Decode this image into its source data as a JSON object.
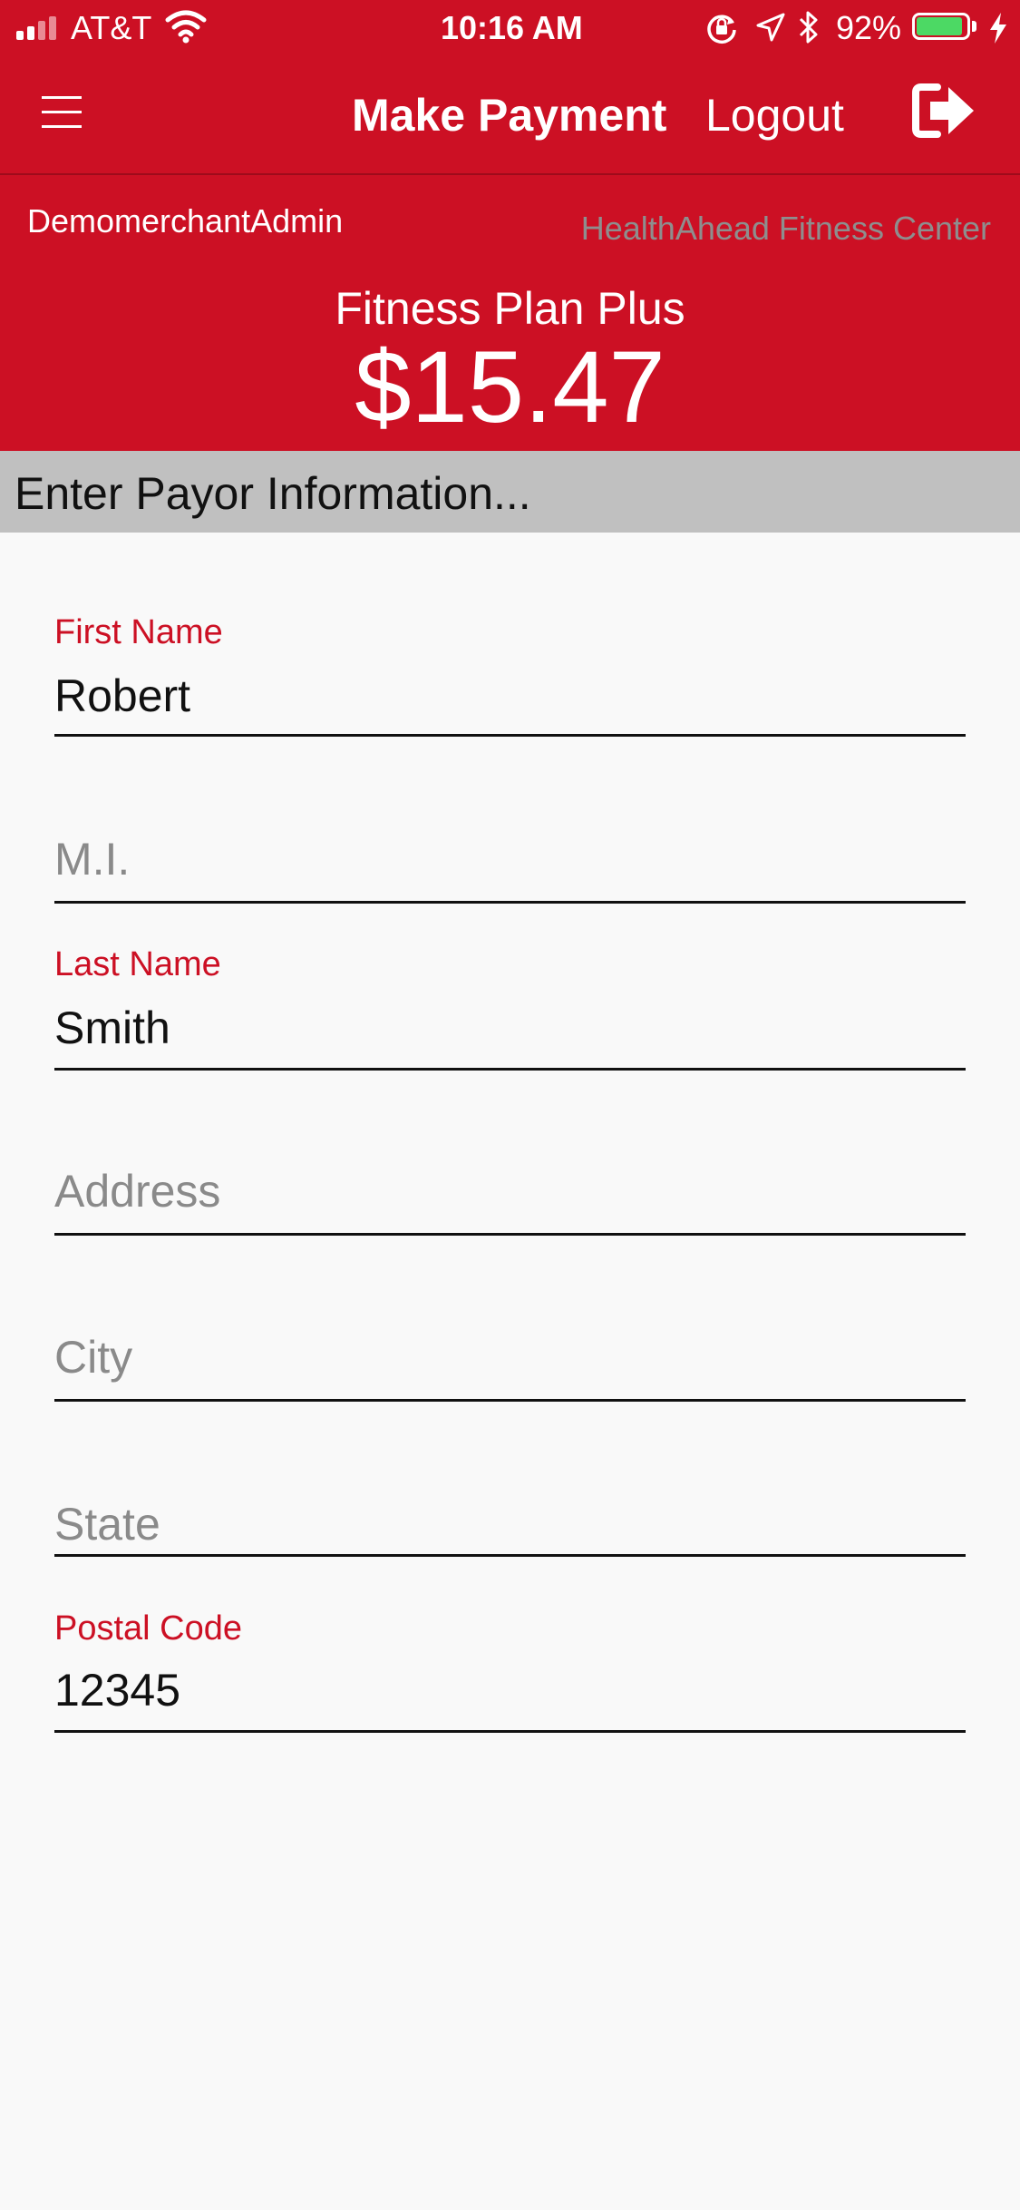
{
  "status_bar": {
    "carrier": "AT&T",
    "time": "10:16 AM",
    "battery_percent": "92%",
    "battery_level": 0.92,
    "icons": [
      "signal-icon",
      "wifi-icon",
      "orientation-lock-icon",
      "location-icon",
      "bluetooth-icon",
      "battery-icon",
      "charging-icon"
    ]
  },
  "navbar": {
    "title": "Make Payment",
    "logout_label": "Logout",
    "menu_icon": "hamburger-menu-icon",
    "logout_icon": "sign-out-icon"
  },
  "header": {
    "username": "DemomerchantAdmin",
    "merchant_name": "HealthAhead Fitness Center",
    "plan_name": "Fitness Plan Plus",
    "amount": "$15.47"
  },
  "section": {
    "title": "Enter Payor Information..."
  },
  "form": {
    "first_name": {
      "label": "First Name",
      "value": "Robert",
      "placeholder": "First Name"
    },
    "middle_initial": {
      "label": "",
      "value": "",
      "placeholder": "M.I."
    },
    "last_name": {
      "label": "Last Name",
      "value": "Smith",
      "placeholder": "Last Name"
    },
    "address": {
      "label": "",
      "value": "",
      "placeholder": "Address"
    },
    "city": {
      "label": "",
      "value": "",
      "placeholder": "City"
    },
    "state": {
      "label": "",
      "value": "",
      "placeholder": "State"
    },
    "postal_code": {
      "label": "Postal Code",
      "value": "12345",
      "placeholder": "Postal Code"
    }
  },
  "colors": {
    "brand_red": "#cc1024",
    "section_gray": "#c0c0c0",
    "background": "#f9f9f9",
    "placeholder_gray": "#8a8a8a",
    "merchant_text_gray": "#8e8e8e",
    "battery_green": "#4cd964"
  }
}
